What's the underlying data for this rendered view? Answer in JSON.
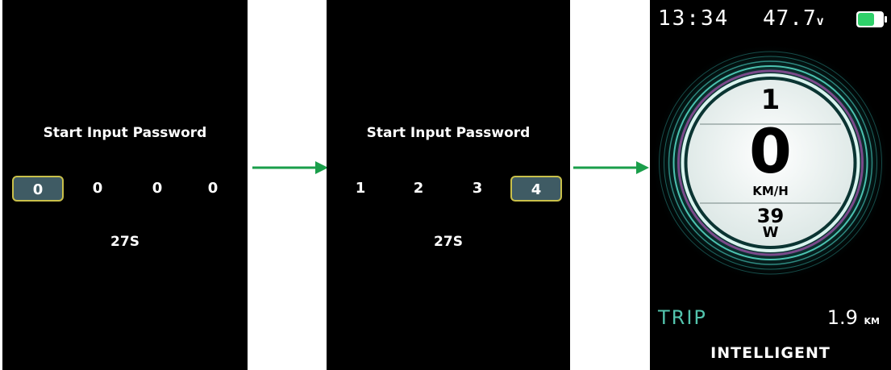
{
  "screen1": {
    "prompt": "Start Input Password",
    "digits": [
      "0",
      "0",
      "0",
      "0"
    ],
    "active_index": 0,
    "timer": "27S"
  },
  "screen2": {
    "prompt": "Start Input Password",
    "digits": [
      "1",
      "2",
      "3",
      "4"
    ],
    "active_index": 3,
    "timer": "27S"
  },
  "dashboard": {
    "time": "13:34",
    "voltage": "47.7",
    "voltage_unit": "v",
    "gear": "1",
    "speed": "0",
    "speed_unit": "KM/H",
    "power": "39",
    "power_unit": "W",
    "trip_label": "TRIP",
    "trip_value": "1.9",
    "trip_unit": "KM",
    "mode": "INTELLIGENT"
  },
  "icons": {
    "arrow": "arrow-right-icon",
    "battery": "battery-icon"
  },
  "colors": {
    "screen_bg": "#000000",
    "digit_highlight_bg": "#3f5b64",
    "digit_highlight_border": "#c9c04a",
    "arrow": "#1a9e4a",
    "teal": "#53c4ad",
    "battery_fill": "#2fd06a"
  }
}
